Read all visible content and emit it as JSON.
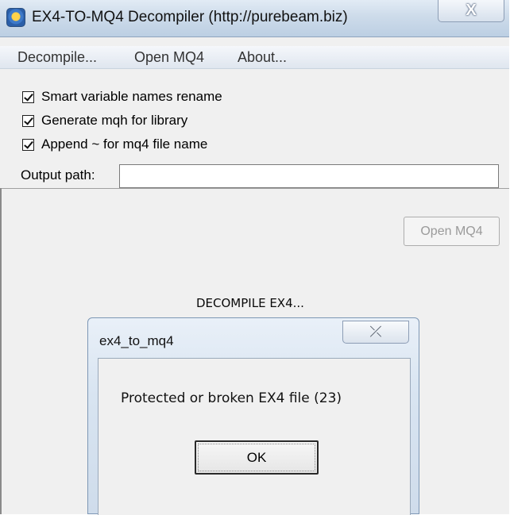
{
  "window": {
    "title": "EX4-TO-MQ4 Decompiler (http://purebeam.biz)",
    "close_glyph": "X",
    "app_icon": "app-icon"
  },
  "menu": {
    "items": [
      "Decompile...",
      "Open MQ4",
      "About..."
    ]
  },
  "options": {
    "checkboxes": [
      {
        "label": "Smart variable names rename",
        "checked": true
      },
      {
        "label": "Generate mqh for library",
        "checked": true
      },
      {
        "label": "Append ~ for mq4 file name",
        "checked": true
      }
    ],
    "output_label": "Output path:",
    "output_value": ""
  },
  "actions": {
    "open_mq4_label": "Open MQ4",
    "open_mq4_disabled": true
  },
  "status_text": "DECOMPILE EX4...",
  "dialog": {
    "title": "ex4_to_mq4",
    "close_glyph": "⤫",
    "message": "Protected or broken EX4 file (23)",
    "ok_label": "OK"
  }
}
